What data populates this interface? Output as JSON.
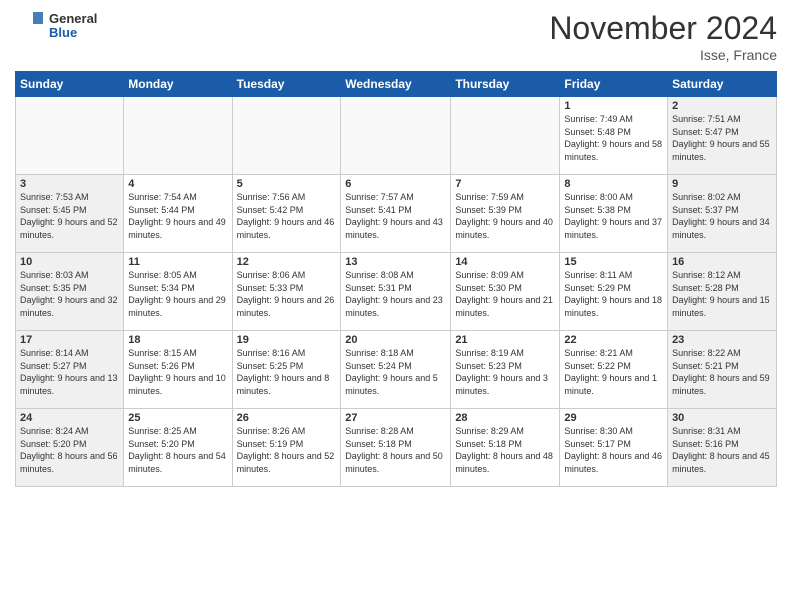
{
  "logo": {
    "text_general": "General",
    "text_blue": "Blue"
  },
  "title": "November 2024",
  "location": "Isse, France",
  "days_of_week": [
    "Sunday",
    "Monday",
    "Tuesday",
    "Wednesday",
    "Thursday",
    "Friday",
    "Saturday"
  ],
  "weeks": [
    [
      {
        "day": "",
        "info": ""
      },
      {
        "day": "",
        "info": ""
      },
      {
        "day": "",
        "info": ""
      },
      {
        "day": "",
        "info": ""
      },
      {
        "day": "",
        "info": ""
      },
      {
        "day": "1",
        "info": "Sunrise: 7:49 AM\nSunset: 5:48 PM\nDaylight: 9 hours and 58 minutes."
      },
      {
        "day": "2",
        "info": "Sunrise: 7:51 AM\nSunset: 5:47 PM\nDaylight: 9 hours and 55 minutes."
      }
    ],
    [
      {
        "day": "3",
        "info": "Sunrise: 7:53 AM\nSunset: 5:45 PM\nDaylight: 9 hours and 52 minutes."
      },
      {
        "day": "4",
        "info": "Sunrise: 7:54 AM\nSunset: 5:44 PM\nDaylight: 9 hours and 49 minutes."
      },
      {
        "day": "5",
        "info": "Sunrise: 7:56 AM\nSunset: 5:42 PM\nDaylight: 9 hours and 46 minutes."
      },
      {
        "day": "6",
        "info": "Sunrise: 7:57 AM\nSunset: 5:41 PM\nDaylight: 9 hours and 43 minutes."
      },
      {
        "day": "7",
        "info": "Sunrise: 7:59 AM\nSunset: 5:39 PM\nDaylight: 9 hours and 40 minutes."
      },
      {
        "day": "8",
        "info": "Sunrise: 8:00 AM\nSunset: 5:38 PM\nDaylight: 9 hours and 37 minutes."
      },
      {
        "day": "9",
        "info": "Sunrise: 8:02 AM\nSunset: 5:37 PM\nDaylight: 9 hours and 34 minutes."
      }
    ],
    [
      {
        "day": "10",
        "info": "Sunrise: 8:03 AM\nSunset: 5:35 PM\nDaylight: 9 hours and 32 minutes."
      },
      {
        "day": "11",
        "info": "Sunrise: 8:05 AM\nSunset: 5:34 PM\nDaylight: 9 hours and 29 minutes."
      },
      {
        "day": "12",
        "info": "Sunrise: 8:06 AM\nSunset: 5:33 PM\nDaylight: 9 hours and 26 minutes."
      },
      {
        "day": "13",
        "info": "Sunrise: 8:08 AM\nSunset: 5:31 PM\nDaylight: 9 hours and 23 minutes."
      },
      {
        "day": "14",
        "info": "Sunrise: 8:09 AM\nSunset: 5:30 PM\nDaylight: 9 hours and 21 minutes."
      },
      {
        "day": "15",
        "info": "Sunrise: 8:11 AM\nSunset: 5:29 PM\nDaylight: 9 hours and 18 minutes."
      },
      {
        "day": "16",
        "info": "Sunrise: 8:12 AM\nSunset: 5:28 PM\nDaylight: 9 hours and 15 minutes."
      }
    ],
    [
      {
        "day": "17",
        "info": "Sunrise: 8:14 AM\nSunset: 5:27 PM\nDaylight: 9 hours and 13 minutes."
      },
      {
        "day": "18",
        "info": "Sunrise: 8:15 AM\nSunset: 5:26 PM\nDaylight: 9 hours and 10 minutes."
      },
      {
        "day": "19",
        "info": "Sunrise: 8:16 AM\nSunset: 5:25 PM\nDaylight: 9 hours and 8 minutes."
      },
      {
        "day": "20",
        "info": "Sunrise: 8:18 AM\nSunset: 5:24 PM\nDaylight: 9 hours and 5 minutes."
      },
      {
        "day": "21",
        "info": "Sunrise: 8:19 AM\nSunset: 5:23 PM\nDaylight: 9 hours and 3 minutes."
      },
      {
        "day": "22",
        "info": "Sunrise: 8:21 AM\nSunset: 5:22 PM\nDaylight: 9 hours and 1 minute."
      },
      {
        "day": "23",
        "info": "Sunrise: 8:22 AM\nSunset: 5:21 PM\nDaylight: 8 hours and 59 minutes."
      }
    ],
    [
      {
        "day": "24",
        "info": "Sunrise: 8:24 AM\nSunset: 5:20 PM\nDaylight: 8 hours and 56 minutes."
      },
      {
        "day": "25",
        "info": "Sunrise: 8:25 AM\nSunset: 5:20 PM\nDaylight: 8 hours and 54 minutes."
      },
      {
        "day": "26",
        "info": "Sunrise: 8:26 AM\nSunset: 5:19 PM\nDaylight: 8 hours and 52 minutes."
      },
      {
        "day": "27",
        "info": "Sunrise: 8:28 AM\nSunset: 5:18 PM\nDaylight: 8 hours and 50 minutes."
      },
      {
        "day": "28",
        "info": "Sunrise: 8:29 AM\nSunset: 5:18 PM\nDaylight: 8 hours and 48 minutes."
      },
      {
        "day": "29",
        "info": "Sunrise: 8:30 AM\nSunset: 5:17 PM\nDaylight: 8 hours and 46 minutes."
      },
      {
        "day": "30",
        "info": "Sunrise: 8:31 AM\nSunset: 5:16 PM\nDaylight: 8 hours and 45 minutes."
      }
    ]
  ]
}
